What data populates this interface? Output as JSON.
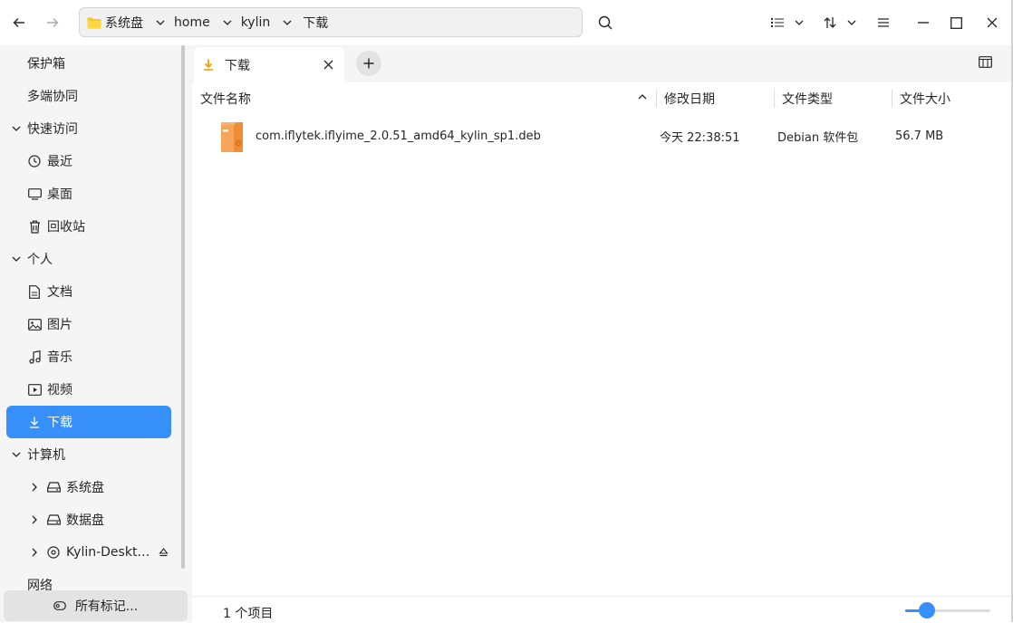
{
  "titlebar": {
    "breadcrumbs": [
      "系统盘",
      "home",
      "kylin",
      "下载"
    ],
    "back_icon": "arrow-left-icon",
    "forward_icon": "arrow-right-icon"
  },
  "sidebar": {
    "items": [
      {
        "label": "保护箱",
        "kind": "plain"
      },
      {
        "label": "多端协同",
        "kind": "plain"
      },
      {
        "label": "快速访问",
        "kind": "section"
      },
      {
        "label": "最近",
        "kind": "child",
        "icon": "clock-icon"
      },
      {
        "label": "桌面",
        "kind": "child",
        "icon": "desktop-icon"
      },
      {
        "label": "回收站",
        "kind": "child",
        "icon": "trash-icon"
      },
      {
        "label": "个人",
        "kind": "section"
      },
      {
        "label": "文档",
        "kind": "child",
        "icon": "document-icon"
      },
      {
        "label": "图片",
        "kind": "child",
        "icon": "image-icon"
      },
      {
        "label": "音乐",
        "kind": "child",
        "icon": "music-icon"
      },
      {
        "label": "视频",
        "kind": "child",
        "icon": "video-icon"
      },
      {
        "label": "下载",
        "kind": "child",
        "icon": "download-icon",
        "active": true
      },
      {
        "label": "计算机",
        "kind": "section"
      },
      {
        "label": "系统盘",
        "kind": "drive",
        "icon": "drive-icon"
      },
      {
        "label": "数据盘",
        "kind": "drive",
        "icon": "drive-icon"
      },
      {
        "label": "Kylin-Deskt…",
        "kind": "drive",
        "icon": "disc-icon",
        "eject": true
      },
      {
        "label": "网络",
        "kind": "plain"
      }
    ],
    "tags_button": "所有标记..."
  },
  "tab": {
    "label": "下载"
  },
  "columns": {
    "name": "文件名称",
    "modified": "修改日期",
    "type": "文件类型",
    "size": "文件大小"
  },
  "files": [
    {
      "name": "com.iflytek.iflyime_2.0.51_amd64_kylin_sp1.deb",
      "modified": "今天 22:38:51",
      "type": "Debian 软件包",
      "size": "56.7 MB",
      "icon": "package-icon"
    }
  ],
  "status": {
    "count_text": "1 个项目",
    "zoom": 0.25
  },
  "colors": {
    "accent": "#3790fa",
    "folder": "#f5c518",
    "package": "#f2a34b"
  }
}
